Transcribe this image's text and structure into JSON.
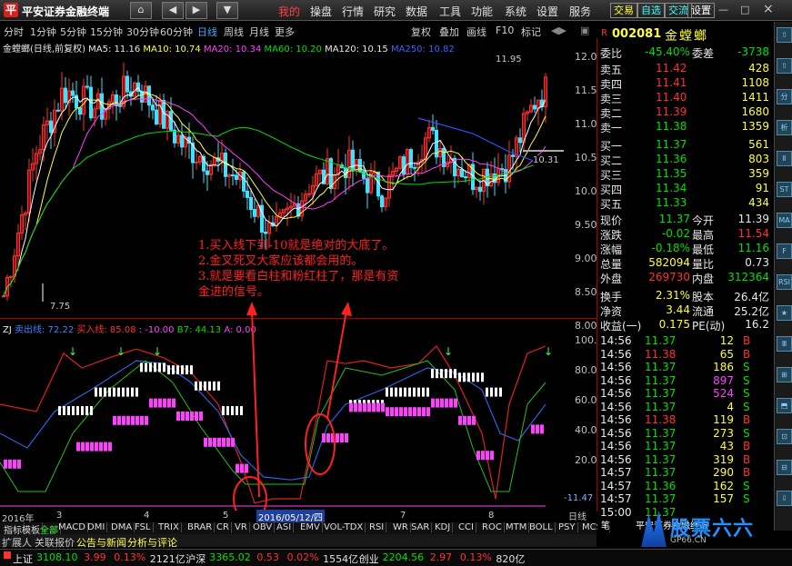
{
  "app": {
    "title": "平安证券金融终端",
    "logo": "平"
  },
  "nav_buttons": [
    "⌂",
    "◀",
    "▶",
    "▼"
  ],
  "menu": [
    "我的",
    "操盘",
    "行情",
    "研究",
    "数据",
    "工具",
    "功能",
    "系统",
    "设置",
    "服务"
  ],
  "right_buttons": [
    {
      "label": "交易",
      "color": "#ffff40"
    },
    {
      "label": "自选",
      "color": "#40ffff"
    },
    {
      "label": "交流",
      "color": "#40ffff"
    },
    {
      "label": "设置",
      "color": "#ffffff"
    }
  ],
  "periods": [
    "分时",
    "1分钟",
    "5分钟",
    "15分钟",
    "30分钟",
    "60分钟",
    "日线",
    "周线",
    "月线",
    "更多"
  ],
  "tools": [
    "复权",
    "叠加",
    "画线",
    "F10",
    "标记"
  ],
  "main_legend": {
    "name": "金螳螂(日线,前复权)",
    "ma5": "MA5: 11.16",
    "ma10": "MA10: 10.74",
    "ma20": "MA20: 10.34",
    "ma60": "MA60: 10.20",
    "ma120": "MA120: 10.15",
    "ma250": "MA250: 10.82"
  },
  "main_axis": [
    "12.00",
    "11.50",
    "11.00",
    "10.50",
    "10.00",
    "9.50",
    "9.00",
    "8.50",
    "8.00"
  ],
  "price_labels": {
    "high": "11.95",
    "low": "7.75",
    "cur": "10.31"
  },
  "ind_legend": {
    "name": "ZJ",
    "sell": "卖出线: 72.22",
    "buy": "买入线: 85.08",
    "line3": ": -10.00",
    "b7": "B7: 44.13",
    "a": "A: 0.00"
  },
  "ind_axis": [
    "100.00",
    "80.00",
    "60.00",
    "40.00",
    "20.00"
  ],
  "ind_bottom_label": "-11.47",
  "date_axis": {
    "year": "2016年",
    "marks": [
      "3",
      "4",
      "5",
      "6",
      "7",
      "8"
    ],
    "cursor": "2016/05/12/四"
  },
  "annotation": [
    "1.买入线下到-10就是绝对的大底了。",
    "2.金叉死叉大家应该都会用的。",
    "3.就是要看白柱和粉红柱了，那是有资",
    "金进的信号。"
  ],
  "ind_tabs": [
    "指标",
    "模板",
    "全部",
    "MACD",
    "DMI",
    "DMA",
    "FSL",
    "TRIX",
    "BRAR",
    "CR",
    "VR",
    "OBV",
    "ASI",
    "EMV",
    "VOL-TDX",
    "RSI",
    "WR",
    "SAR",
    "KDJ",
    "CCI",
    "ROC",
    "MTM",
    "BOLL",
    "PSY",
    "MCST"
  ],
  "bottom_tabs": [
    "扩展人",
    "关联报价",
    "公告与新闻",
    "分析与评论"
  ],
  "period_tag": "日线",
  "stock": {
    "code": "002081",
    "name": "金螳螂",
    "tag": "R"
  },
  "weibi": {
    "label": "委比",
    "value": "-45.40%",
    "wc_label": "委差",
    "wc": "-3738"
  },
  "sells": [
    {
      "l": "卖五",
      "p": "11.42",
      "v": "428"
    },
    {
      "l": "卖四",
      "p": "11.41",
      "v": "1108"
    },
    {
      "l": "卖三",
      "p": "11.40",
      "v": "1411"
    },
    {
      "l": "卖二",
      "p": "11.39",
      "v": "1680"
    },
    {
      "l": "卖一",
      "p": "11.38",
      "v": "1359"
    }
  ],
  "buys": [
    {
      "l": "买一",
      "p": "11.37",
      "v": "561"
    },
    {
      "l": "买二",
      "p": "11.36",
      "v": "803"
    },
    {
      "l": "买三",
      "p": "11.35",
      "v": "359"
    },
    {
      "l": "买四",
      "p": "11.34",
      "v": "91"
    },
    {
      "l": "买五",
      "p": "11.33",
      "v": "434"
    }
  ],
  "quote": [
    {
      "l1": "现价",
      "v1": "11.37",
      "l2": "今开",
      "v2": "11.39"
    },
    {
      "l1": "涨跌",
      "v1": "-0.02",
      "l2": "最高",
      "v2": "11.54"
    },
    {
      "l1": "涨幅",
      "v1": "-0.18%",
      "l2": "最低",
      "v2": "11.16"
    },
    {
      "l1": "总量",
      "v1": "582094",
      "l2": "量比",
      "v2": "0.73"
    },
    {
      "l1": "外盘",
      "v1": "269730",
      "l2": "内盘",
      "v2": "312364"
    }
  ],
  "quote2": [
    {
      "l1": "换手",
      "v1": "2.31%",
      "l2": "股本",
      "v2": "26.4亿"
    },
    {
      "l1": "净资",
      "v1": "3.44",
      "l2": "流通",
      "v2": "25.2亿"
    },
    {
      "l1": "收益(一)",
      "v1": "0.175",
      "l2": "PE(动)",
      "v2": "16.2"
    }
  ],
  "ticks": [
    {
      "t": "14:56",
      "p": "11.37",
      "v": "12",
      "s": "B"
    },
    {
      "t": "14:56",
      "p": "11.38",
      "v": "65",
      "s": "B"
    },
    {
      "t": "14:56",
      "p": "11.37",
      "v": "186",
      "s": "S"
    },
    {
      "t": "14:56",
      "p": "11.37",
      "v": "897",
      "s": "S"
    },
    {
      "t": "14:56",
      "p": "11.37",
      "v": "524",
      "s": "S"
    },
    {
      "t": "14:56",
      "p": "11.37",
      "v": "4",
      "s": "S"
    },
    {
      "t": "14:56",
      "p": "11.38",
      "v": "119",
      "s": "B"
    },
    {
      "t": "14:56",
      "p": "11.37",
      "v": "273",
      "s": "S"
    },
    {
      "t": "14:56",
      "p": "11.37",
      "v": "43",
      "s": "B"
    },
    {
      "t": "14:56",
      "p": "11.37",
      "v": "319",
      "s": "B"
    },
    {
      "t": "14:57",
      "p": "11.37",
      "v": "290",
      "s": "B"
    },
    {
      "t": "14:57",
      "p": "11.36",
      "v": "162",
      "s": "S"
    },
    {
      "t": "14:57",
      "p": "11.37",
      "v": "157",
      "s": "S"
    },
    {
      "t": "15:00",
      "p": "11.37",
      "v": "",
      "s": ""
    }
  ],
  "right_bottom_tab": "笔",
  "right_bottom_brand": "平安证券金融终端",
  "status": [
    {
      "l": "上证",
      "v": "3108.10",
      "c": "#00e000"
    },
    {
      "l": "",
      "v": "3.99",
      "c": "#ff3030"
    },
    {
      "l": "",
      "v": "0.13%",
      "c": "#ff3030"
    },
    {
      "l": "",
      "v": "2121亿",
      "c": "#e0e0e0"
    },
    {
      "l": "沪深",
      "v": "3365.02",
      "c": "#00e000"
    },
    {
      "l": "",
      "v": "0.53",
      "c": "#ff3030"
    },
    {
      "l": "",
      "v": "0.02%",
      "c": "#ff3030"
    },
    {
      "l": "",
      "v": "1554亿",
      "c": "#e0e0e0"
    },
    {
      "l": "创业",
      "v": "2204.56",
      "c": "#00e000"
    },
    {
      "l": "",
      "v": "2.97",
      "c": "#ff3030"
    },
    {
      "l": "",
      "v": "0.13%",
      "c": "#ff3030"
    },
    {
      "l": "",
      "v": "820亿",
      "c": "#e0e0e0"
    }
  ],
  "watermark": {
    "big": "股票六六",
    "small": "GP66.CN"
  },
  "side_icons": [
    "⇧",
    "⇧",
    "分",
    "析",
    "Ⅱ",
    "ST",
    "MA",
    "F",
    "RSI",
    "★",
    "Ⅲ",
    "⊞",
    "⬒",
    "⊡",
    "⊟",
    "⇩"
  ]
}
